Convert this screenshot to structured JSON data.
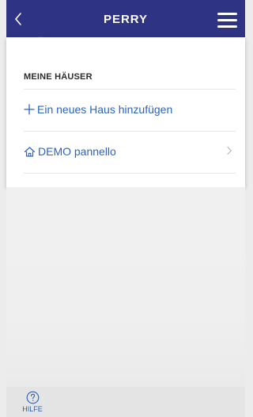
{
  "header": {
    "title": "PERRY",
    "residue_text": "..."
  },
  "panel": {
    "section_title": "MEINE HÄUSER",
    "items": [
      {
        "label": "Ein neues Haus hinzufügen",
        "icon": "plus-icon"
      },
      {
        "label": "DEMO pannello",
        "icon": "home-icon",
        "trailing_icon": "chevron-right-icon"
      }
    ]
  },
  "footer": {
    "help_label": "HILFE",
    "help_icon": "question-circle-icon"
  },
  "colors": {
    "header_bg": "#2e3483",
    "panel_bg": "#ffffff",
    "link": "#2b63c0",
    "page_bg": "#ececec",
    "footer_bg": "#e4e4e4"
  }
}
